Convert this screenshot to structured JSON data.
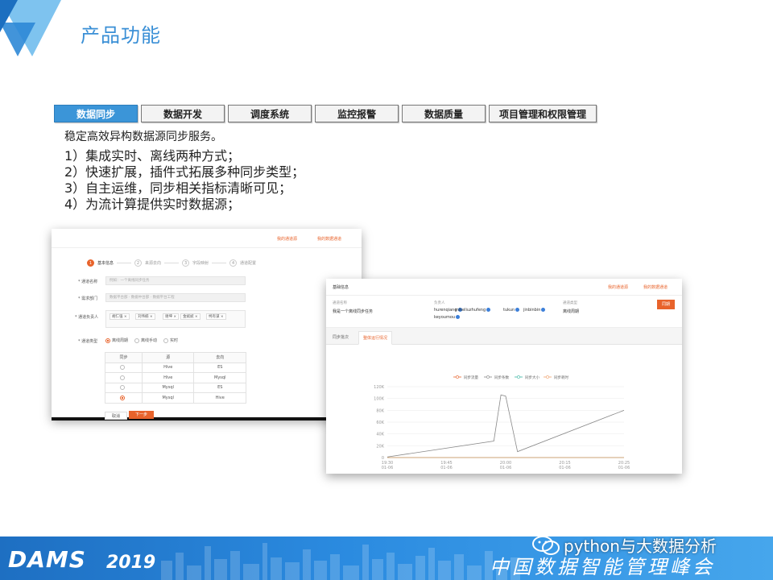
{
  "slide": {
    "title": "产品功能",
    "tabs": [
      {
        "label": "数据同步",
        "active": true
      },
      {
        "label": "数据开发",
        "active": false
      },
      {
        "label": "调度系统",
        "active": false
      },
      {
        "label": "监控报警",
        "active": false
      },
      {
        "label": "数据质量",
        "active": false
      },
      {
        "label": "项目管理和权限管理",
        "active": false
      }
    ],
    "description": "稳定高效异构数据源同步服务。",
    "points": [
      "1）集成实时、离线两种方式；",
      "2）快速扩展，插件式拓展多种同步类型；",
      "3）自主运维，同步相关指标清晰可见；",
      "4）为流计算提供实时数据源；"
    ]
  },
  "left_panel": {
    "links": [
      "我的通道源",
      "我的数据通道"
    ],
    "steps": [
      {
        "num": "1",
        "label": "基本信息",
        "active": true
      },
      {
        "num": "2",
        "label": "来源去向",
        "active": false
      },
      {
        "num": "3",
        "label": "字段映射",
        "active": false
      },
      {
        "num": "4",
        "label": "通道配置",
        "active": false
      }
    ],
    "fields": {
      "name_label": "* 通道名称",
      "name_placeholder": "例如：一个离线同步任务",
      "dept_label": "* 需求部门",
      "dept_placeholder": "数据平台部 · 数据中台部 · 数据平台工程",
      "owner_label": "* 通道负责人",
      "owners": [
        "胡仁强 ×",
        "刘伟楠 ×",
        "谢坤 ×",
        "金斌斌 ×",
        "柯有谋 ×"
      ],
      "type_label": "* 通道类型",
      "type_options": [
        {
          "label": "离线周期",
          "selected": true
        },
        {
          "label": "离线手动",
          "selected": false
        },
        {
          "label": "实时",
          "selected": false
        }
      ]
    },
    "table": {
      "headers": [
        "同步",
        "源",
        "去向"
      ],
      "rows": [
        {
          "selected": false,
          "source": "Hive",
          "target": "ES"
        },
        {
          "selected": false,
          "source": "Hive",
          "target": "Mysql"
        },
        {
          "selected": false,
          "source": "Mysql",
          "target": "ES"
        },
        {
          "selected": true,
          "source": "Mysql",
          "target": "Hive"
        }
      ]
    },
    "buttons": {
      "cancel": "取消",
      "next": "下一步"
    }
  },
  "right_panel": {
    "section_title": "基础信息",
    "links": [
      "我的通道源",
      "我的数据通道"
    ],
    "name_key": "通道名称",
    "name_value": "我是一个离线同步任务",
    "owner_key": "负责人",
    "owners": [
      "hurenqiang",
      "mikeliuzhufeng",
      "tukun",
      "jinbinbin",
      "keyoumou"
    ],
    "type_key": "通道类型",
    "type_value": "离线周期",
    "button": "同期",
    "tabs": [
      {
        "label": "同步批次",
        "active": false
      },
      {
        "label": "整体运行情况",
        "active": true
      }
    ]
  },
  "chart_data": {
    "type": "line",
    "legend": [
      "同步流量",
      "同步条数",
      "同步大小",
      "同步耗时"
    ],
    "legend_placement": "top-center",
    "grid": true,
    "yticks": [
      "0",
      "20K",
      "40K",
      "60K",
      "80K",
      "100K",
      "120K"
    ],
    "ylim": [
      0,
      120000
    ],
    "xticks": [
      {
        "time": "19:30",
        "date": "01-06"
      },
      {
        "time": "19:45",
        "date": "01-06"
      },
      {
        "time": "20:00",
        "date": "01-06"
      },
      {
        "time": "20:15",
        "date": "01-06"
      },
      {
        "time": "20:25",
        "date": "01-06"
      }
    ],
    "series": [
      {
        "name": "同步条数",
        "color": "#888888",
        "x": [
          0,
          0.45,
          0.48,
          0.5,
          0.55,
          1.0
        ],
        "y": [
          1000,
          28000,
          106000,
          104000,
          10000,
          80000
        ]
      },
      {
        "name": "同步流量",
        "color": "#e8632b",
        "x": [
          0,
          1.0
        ],
        "y": [
          0,
          0
        ]
      },
      {
        "name": "同步大小",
        "color": "#3db8a4",
        "x": [
          0,
          1.0
        ],
        "y": [
          0,
          0
        ]
      },
      {
        "name": "同步耗时",
        "color": "#f0a06b",
        "x": [
          0,
          1.0
        ],
        "y": [
          0,
          0
        ]
      }
    ]
  },
  "footer": {
    "brand": "DAMS",
    "year": "2019",
    "conference": "中国数据智能管理峰会",
    "watermark": "python与大数据分析"
  }
}
